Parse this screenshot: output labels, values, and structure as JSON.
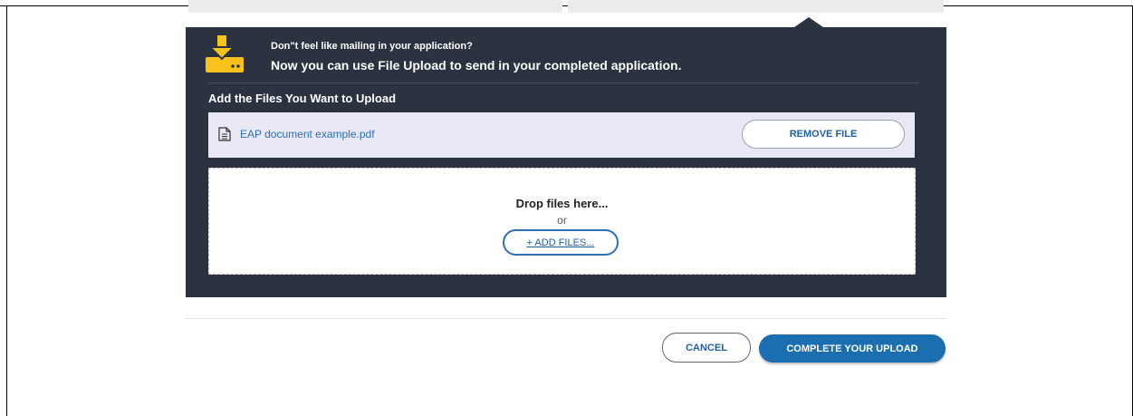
{
  "upload_panel": {
    "promo_line1": "Don\"t feel like mailing in your application?",
    "promo_line2": "Now you can use File Upload to send in your completed application.",
    "section_title": "Add the Files You Want to Upload",
    "files": [
      {
        "name": "EAP document example.pdf",
        "remove_label": "REMOVE FILE"
      }
    ],
    "drop_zone": {
      "text": "Drop files here...",
      "or_text": "or",
      "add_label": "+ ADD FILES..."
    }
  },
  "footer": {
    "cancel_label": "CANCEL",
    "complete_label": "COMPLETE YOUR UPLOAD"
  },
  "icons": {
    "download": "download-icon",
    "file": "file-document-icon"
  },
  "colors": {
    "panel_bg": "#2a333f",
    "accent_yellow": "#f6c21b",
    "link_blue": "#1e5fa6",
    "primary_button": "#1b6fb0",
    "file_row_bg": "#e9e8f5"
  }
}
